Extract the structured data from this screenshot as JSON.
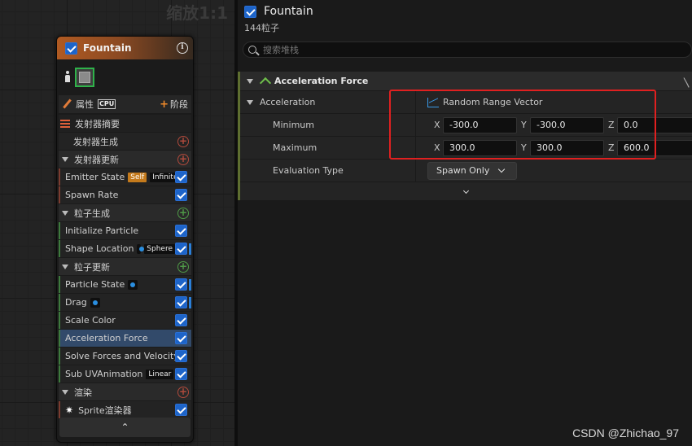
{
  "graph": {
    "zoom_label": "缩放1:1"
  },
  "node": {
    "title": "Fountain",
    "properties_label": "属性",
    "cpu_badge": "CPU",
    "stage_label": "阶段",
    "rows": [
      {
        "kind": "summary",
        "label": "发射器摘要"
      },
      {
        "kind": "plain",
        "label": "发射器生成",
        "add": "red"
      },
      {
        "kind": "section",
        "label": "发射器更新",
        "add": "red"
      },
      {
        "kind": "mod",
        "label": "Emitter State",
        "badges": [
          "Self",
          "Infinite"
        ],
        "checked": true,
        "color": "red"
      },
      {
        "kind": "mod",
        "label": "Spawn Rate",
        "checked": true,
        "color": "red"
      },
      {
        "kind": "section",
        "label": "粒子生成",
        "add": "green"
      },
      {
        "kind": "mod",
        "label": "Initialize Particle",
        "checked": true,
        "color": "green"
      },
      {
        "kind": "mod",
        "label": "Shape Location",
        "dot": true,
        "badges": [
          "Sphere"
        ],
        "checked": true,
        "color": "green",
        "side": true
      },
      {
        "kind": "section",
        "label": "粒子更新",
        "add": "green"
      },
      {
        "kind": "mod",
        "label": "Particle State",
        "dot": true,
        "checked": true,
        "color": "green",
        "side": true
      },
      {
        "kind": "mod",
        "label": "Drag",
        "dot": true,
        "checked": true,
        "color": "green",
        "side": true
      },
      {
        "kind": "mod",
        "label": "Scale Color",
        "checked": true,
        "color": "green"
      },
      {
        "kind": "mod",
        "label": "Acceleration Force",
        "checked": true,
        "color": "green",
        "selected": true
      },
      {
        "kind": "mod",
        "label": "Solve Forces and Velocity",
        "checked": true,
        "color": "green"
      },
      {
        "kind": "mod",
        "label": "Sub UVAnimation",
        "badges": [
          "Linear"
        ],
        "checked": true,
        "color": "green"
      },
      {
        "kind": "section",
        "label": "渲染",
        "add": "red"
      },
      {
        "kind": "render",
        "label": "Sprite渲染器",
        "checked": true
      }
    ],
    "collapse_glyph": "⌃"
  },
  "details": {
    "title": "Fountain",
    "subtitle": "144粒子",
    "search_placeholder": "搜索堆栈",
    "section_title": "Acceleration Force",
    "acceleration_label": "Acceleration",
    "mode_label": "Random Range Vector",
    "minimum_label": "Minimum",
    "maximum_label": "Maximum",
    "minimum": {
      "x": "-300.0",
      "y": "-300.0",
      "z": "0.0"
    },
    "maximum": {
      "x": "300.0",
      "y": "300.0",
      "z": "600.0"
    },
    "axes": {
      "x": "X",
      "y": "Y",
      "z": "Z"
    },
    "evaluation_label": "Evaluation Type",
    "evaluation_value": "Spawn Only",
    "annotation_color": "#e02020"
  },
  "watermark": "CSDN @Zhichao_97"
}
